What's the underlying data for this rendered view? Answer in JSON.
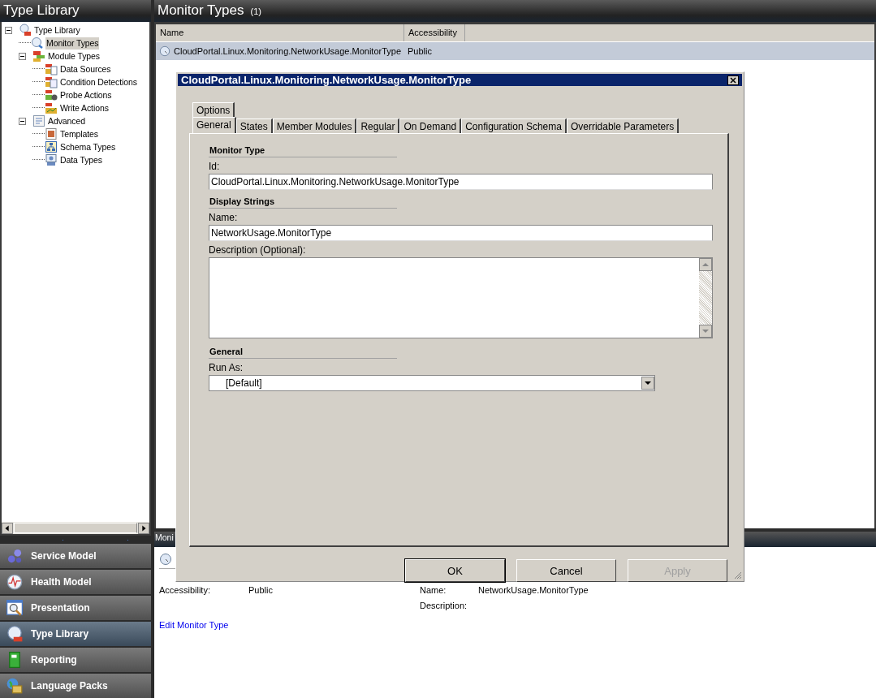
{
  "sidebar": {
    "title": "Type Library",
    "tree": [
      {
        "label": "Type Library",
        "expanded": true,
        "selected": false,
        "children": [
          {
            "label": "Monitor Types",
            "selected": true
          },
          {
            "label": "Module Types",
            "expanded": true,
            "selected": false,
            "children": [
              {
                "label": "Data Sources",
                "selected": false
              },
              {
                "label": "Condition Detections",
                "selected": false
              },
              {
                "label": "Probe Actions",
                "selected": false
              },
              {
                "label": "Write Actions",
                "selected": false
              }
            ]
          },
          {
            "label": "Advanced",
            "expanded": true,
            "selected": false,
            "children": [
              {
                "label": "Templates",
                "selected": false
              },
              {
                "label": "Schema Types",
                "selected": false
              },
              {
                "label": "Data Types",
                "selected": false
              }
            ]
          }
        ]
      }
    ]
  },
  "nav": [
    {
      "label": "Service Model",
      "selected": false
    },
    {
      "label": "Health Model",
      "selected": false
    },
    {
      "label": "Presentation",
      "selected": false
    },
    {
      "label": "Type Library",
      "selected": true
    },
    {
      "label": "Reporting",
      "selected": false
    },
    {
      "label": "Language Packs",
      "selected": false
    }
  ],
  "main": {
    "title": "Monitor Types",
    "count": "(1)",
    "columns": [
      "Name",
      "Accessibility"
    ],
    "rows": [
      {
        "cells": [
          "CloudPortal.Linux.Monitoring.NetworkUsage.MonitorType",
          "Public"
        ],
        "selected": true
      }
    ]
  },
  "details": {
    "header": "Moni",
    "fields": [
      {
        "label": "Accessibility:",
        "value": "Public"
      },
      {
        "label": "Name:",
        "value": "NetworkUsage.MonitorType"
      },
      {
        "label": "Description:"
      }
    ],
    "link": "Edit Monitor Type"
  },
  "dialog": {
    "title": "CloudPortal.Linux.Monitoring.NetworkUsage.MonitorType",
    "tab_rows": [
      [
        {
          "label": "Options",
          "selected": false
        }
      ],
      [
        {
          "label": "General",
          "selected": true
        },
        {
          "label": "States",
          "selected": false
        },
        {
          "label": "Member Modules",
          "selected": false
        },
        {
          "label": "Regular",
          "selected": false
        },
        {
          "label": "On Demand",
          "selected": false
        },
        {
          "label": "Configuration Schema",
          "selected": false
        },
        {
          "label": "Overridable Parameters",
          "selected": false
        }
      ]
    ],
    "sections": [
      {
        "heading": "Monitor Type",
        "fields": [
          {
            "kind": "text",
            "label": "Id:",
            "value": "CloudPortal.Linux.Monitoring.NetworkUsage.MonitorType"
          }
        ]
      },
      {
        "heading": "Display Strings",
        "fields": [
          {
            "kind": "text",
            "label": "Name:",
            "value": "NetworkUsage.MonitorType"
          },
          {
            "kind": "textarea",
            "label": "Description (Optional):"
          }
        ]
      },
      {
        "heading": "General",
        "fields": [
          {
            "kind": "select",
            "label": "Run As:",
            "value": "[Default]"
          }
        ]
      }
    ],
    "buttons": [
      {
        "label": "OK",
        "default": true,
        "disabled": false
      },
      {
        "label": "Cancel",
        "default": false,
        "disabled": false
      },
      {
        "label": "Apply",
        "default": false,
        "disabled": true
      }
    ]
  }
}
